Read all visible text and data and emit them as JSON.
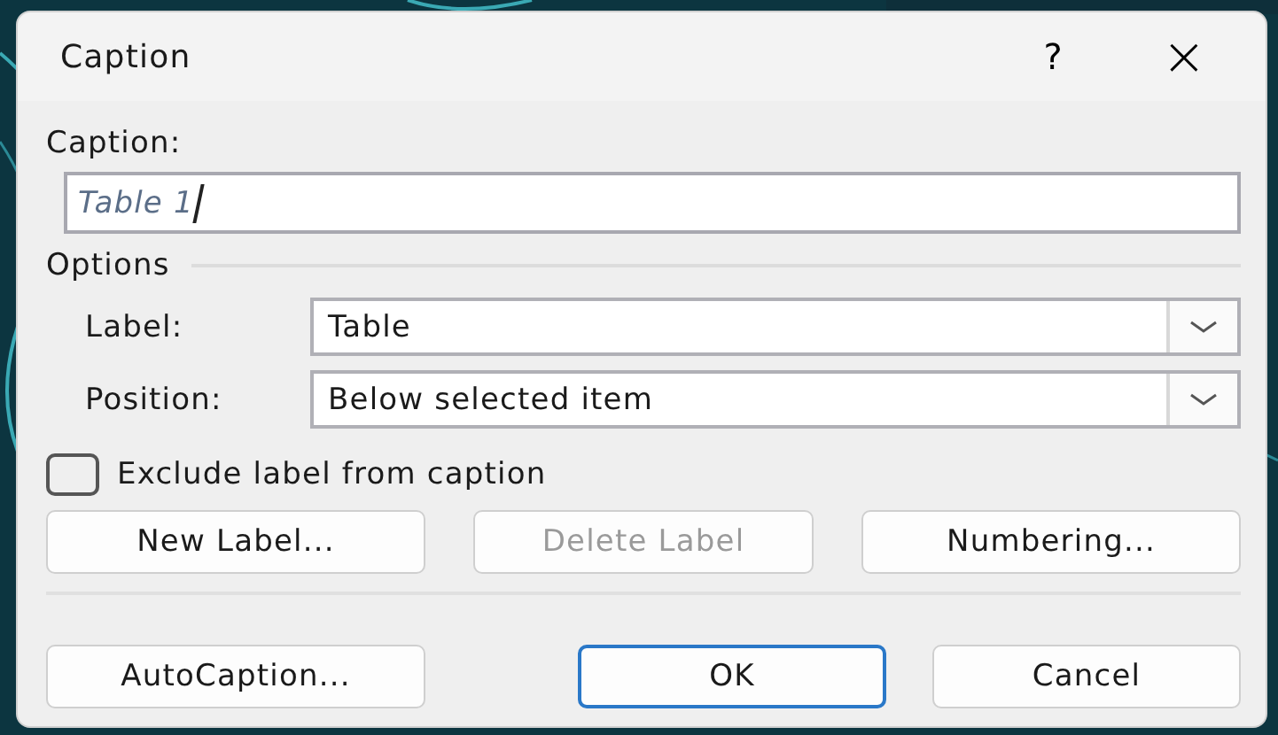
{
  "window": {
    "title": "Caption",
    "help": "?",
    "close": "×"
  },
  "caption": {
    "label": "Caption:",
    "value": "Table 1"
  },
  "options": {
    "title": "Options",
    "fields": [
      {
        "label": "Label:",
        "value": "Table"
      },
      {
        "label": "Position:",
        "value": "Below selected item"
      }
    ]
  },
  "exclude": {
    "label": "Exclude label from caption",
    "checked": false
  },
  "label_buttons": [
    {
      "label": "New Label...",
      "disabled": false
    },
    {
      "label": "Delete Label",
      "disabled": true
    },
    {
      "label": "Numbering...",
      "disabled": false
    }
  ],
  "footer_buttons": [
    {
      "label": "AutoCaption...",
      "default": false
    },
    {
      "label": "OK",
      "default": true
    },
    {
      "label": "Cancel",
      "default": false
    }
  ]
}
